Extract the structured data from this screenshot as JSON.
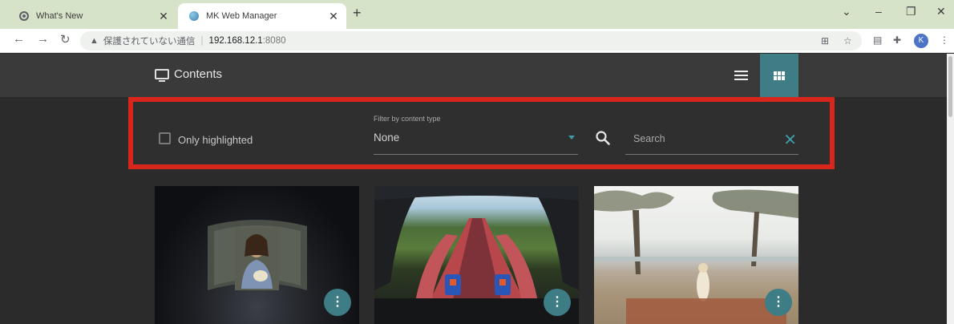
{
  "browser": {
    "tabs": [
      {
        "title": "What's New",
        "active": false
      },
      {
        "title": "MK Web Manager",
        "active": true
      }
    ],
    "url": {
      "security_text": "保護されていない通信",
      "host": "192.168.12.1",
      "port": ":8080"
    },
    "profile_initial": "K"
  },
  "app": {
    "title": "Contents",
    "view_modes": [
      "list",
      "grid"
    ],
    "active_view": "grid"
  },
  "filters": {
    "only_highlighted_label": "Only highlighted",
    "only_highlighted_checked": false,
    "content_type_label": "Filter by content type",
    "content_type_value": "None",
    "search_placeholder": "Search"
  },
  "contents": [
    {
      "thumbnail": "portrait painting in dark room",
      "menu_icon": "more-vert-icon"
    },
    {
      "thumbnail": "roller coaster ride view",
      "menu_icon": "more-vert-icon"
    },
    {
      "thumbnail": "beach with trees",
      "menu_icon": "more-vert-icon"
    }
  ],
  "colors": {
    "accent": "#3e7d86",
    "highlight_border": "#d9261c",
    "app_bg": "#2b2b2b",
    "appbar_bg": "#3a3a3a",
    "tabbar_bg": "#d7e3c8"
  }
}
